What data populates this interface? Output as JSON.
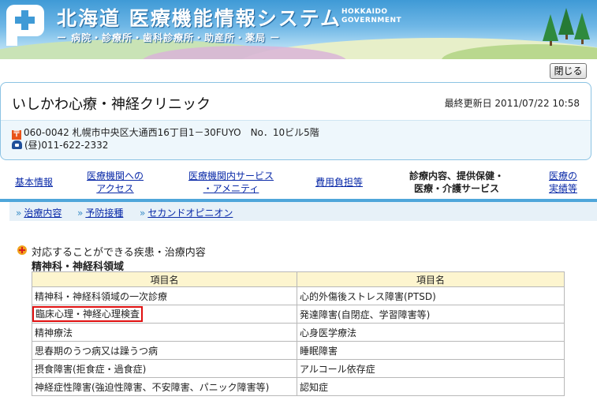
{
  "banner": {
    "title": "北海道 医療機能情報システム",
    "title_en_line1": "HOKKAIDO",
    "title_en_line2": "GOVERNMENT",
    "subtitle": "ー 病院・診療所・歯科診療所・助産所・薬局 ー"
  },
  "close_button": "閉じる",
  "clinic": {
    "name": "いしかわ心療・神経クリニック",
    "updated": "最終更新日 2011/07/22 10:58",
    "address": "060-0042 札幌市中央区大通西16丁目1－30FUYO　No．10ビル5階",
    "tel": "(昼)011-622-2332",
    "post_symbol": "〒"
  },
  "tabs": [
    {
      "line1": "基本情報",
      "line2": ""
    },
    {
      "line1": "医療機関への",
      "line2": "アクセス"
    },
    {
      "line1": "医療機関内サービス",
      "line2": "・アメニティ"
    },
    {
      "line1": "費用負担等",
      "line2": ""
    },
    {
      "line1": "診療内容、提供保健・",
      "line2": "医療・介護サービス"
    },
    {
      "line1": "医療の",
      "line2": "実績等"
    }
  ],
  "subnav": {
    "marker": "»",
    "items": [
      "治療内容",
      "予防接種",
      "セカンドオピニオン"
    ]
  },
  "section": {
    "title": "対応することができる疾患・治療内容",
    "field": "精神科・神経科領域",
    "headers": [
      "項目名",
      "項目名"
    ],
    "rows": [
      [
        "精神科・神経科領域の一次診療",
        "心的外傷後ストレス障害(PTSD)"
      ],
      [
        "臨床心理・神経心理検査",
        "発達障害(自閉症、学習障害等)"
      ],
      [
        "精神療法",
        "心身医学療法"
      ],
      [
        "思春期のうつ病又は躁うつ病",
        "睡眠障害"
      ],
      [
        "摂食障害(拒食症・過食症)",
        "アルコール依存症"
      ],
      [
        "神経症性障害(強迫性障害、不安障害、パニック障害等)",
        "認知症"
      ]
    ]
  },
  "colors": {
    "accent_blue": "#4fa6da",
    "header_yellow": "#fdf5cf",
    "highlight_red": "#e01010",
    "link": "#0a2aa8"
  }
}
